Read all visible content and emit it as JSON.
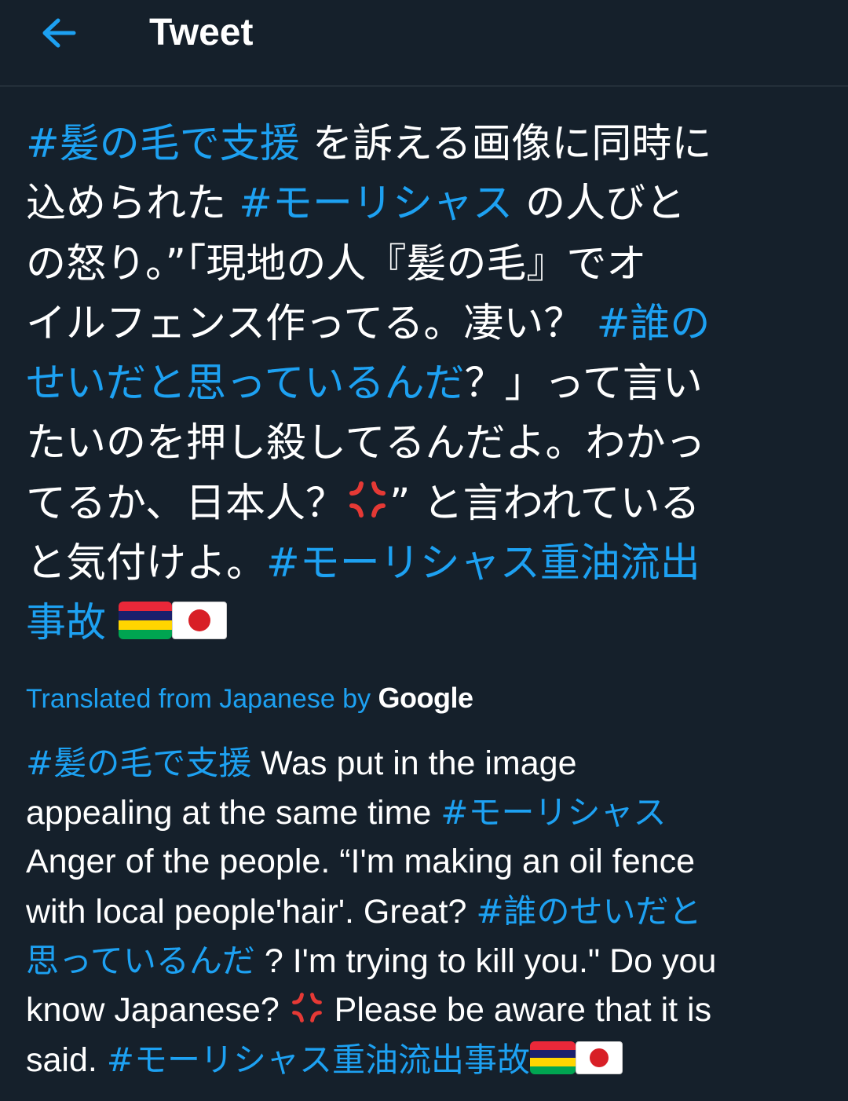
{
  "header": {
    "back_icon": "arrow-left-icon",
    "title": "Tweet"
  },
  "colors": {
    "background": "#15202b",
    "accent": "#1da1f2",
    "text": "#ffffff",
    "divider": "#38444d"
  },
  "tweet": {
    "lines": [
      [
        {
          "t": "#髪の毛で支援",
          "h": true
        },
        {
          "t": " を訴える画像に同時に"
        }
      ],
      [
        {
          "t": "込められた "
        },
        {
          "t": "#モーリシャス",
          "h": true
        },
        {
          "t": " の人びと"
        }
      ],
      [
        {
          "t": "の怒り。”「現地の人『髪の毛』でオ"
        }
      ],
      [
        {
          "t": "イルフェンス作ってる。凄い？ "
        },
        {
          "t": "#誰の",
          "h": true
        }
      ],
      [
        {
          "t": "せいだと思っているんだ",
          "h": true
        },
        {
          "t": "？」って言い"
        }
      ],
      [
        {
          "t": "たいのを押し殺してるんだよ。わかっ"
        }
      ],
      [
        {
          "t": "てるか、日本人？"
        },
        {
          "e": "anger"
        },
        {
          "t": "” と言われている"
        }
      ],
      [
        {
          "t": "と気付けよ。"
        },
        {
          "t": "#モーリシャス重油流出",
          "h": true
        }
      ],
      [
        {
          "t": "事故",
          "h": true
        },
        {
          "t": " "
        },
        {
          "e": "flag-mu"
        },
        {
          "e": "flag-jp"
        }
      ]
    ]
  },
  "translation": {
    "label": "Translated from Japanese by ",
    "provider": "Google",
    "lines": [
      [
        {
          "t": "#髪の毛で支援",
          "h": true
        },
        {
          "t": " Was put in the image"
        }
      ],
      [
        {
          "t": "appealing at the same time "
        },
        {
          "t": "#モーリシャス",
          "h": true
        }
      ],
      [
        {
          "t": "Anger of the people. “I'm making an oil fence"
        }
      ],
      [
        {
          "t": "with local people'hair'. Great? "
        },
        {
          "t": "#誰のせいだと",
          "h": true
        }
      ],
      [
        {
          "t": "思っているんだ",
          "h": true
        },
        {
          "t": " ? I'm trying to kill you.\" Do you"
        }
      ],
      [
        {
          "t": "know Japanese? "
        },
        {
          "e": "anger"
        },
        {
          "t": " Please be aware that it is"
        }
      ],
      [
        {
          "t": "said. "
        },
        {
          "t": "#モーリシャス重油流出事故",
          "h": true
        },
        {
          "e": "flag-mu"
        },
        {
          "e": "flag-jp"
        }
      ]
    ]
  },
  "emoji_names": {
    "anger": "anger-symbol-icon",
    "flag-mu": "flag-mauritius-icon",
    "flag-jp": "flag-japan-icon"
  }
}
